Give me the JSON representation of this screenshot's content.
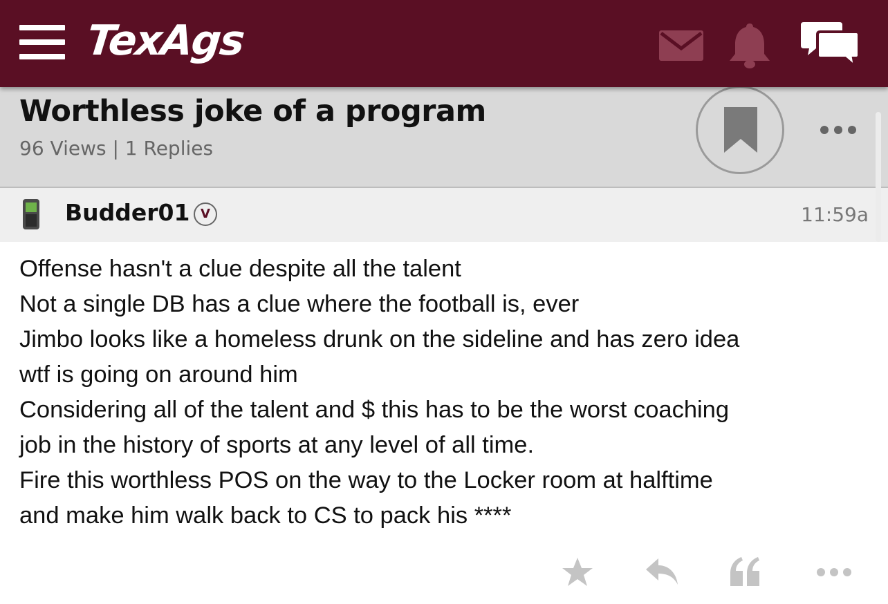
{
  "app": {
    "logo": "TexAgs",
    "brand_color": "#5a0f24"
  },
  "topbar": {
    "icons": [
      "hamburger-menu-icon",
      "mail-icon",
      "bell-icon",
      "chat-icon"
    ]
  },
  "thread": {
    "title": "Worthless joke of a program",
    "meta": "96 Views | 1 Replies"
  },
  "post": {
    "username": "Budder01",
    "badge": "V",
    "time": "11:59a",
    "lines": [
      "Offense hasn't a clue despite all the talent",
      "Not a single DB has a clue where the football is, ever",
      "Jimbo looks like a homeless drunk on the sideline and has zero idea",
      "wtf is going on around him",
      "Considering all of the talent and $ this has to be the worst coaching",
      "job in the history of sports at any level of all time.",
      "Fire this worthless POS on the way to the Locker room at halftime",
      "and make him walk back to CS to pack his ****"
    ]
  },
  "actions": [
    "star-icon",
    "reply-icon",
    "quote-icon",
    "more-icon"
  ]
}
